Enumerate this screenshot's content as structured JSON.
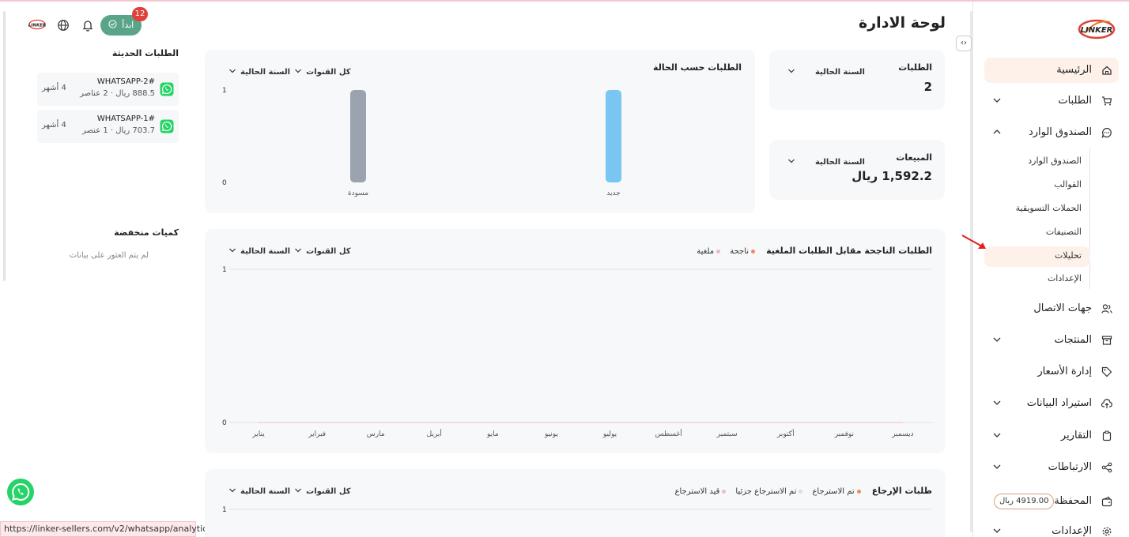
{
  "header": {
    "title": "لوحة الادارة",
    "start_button": "ابدأ",
    "notification_count": "12"
  },
  "sidebar": {
    "items": [
      {
        "label": "الرئيسية",
        "icon": "home-icon",
        "active": true
      },
      {
        "label": "الطلبات",
        "icon": "cart-icon"
      },
      {
        "label": "الصندوق الوارد",
        "icon": "chat-icon"
      },
      {
        "label": "جهات الاتصال",
        "icon": "users-icon"
      },
      {
        "label": "المنتجات",
        "icon": "archive-icon"
      },
      {
        "label": "إدارة الأسعار",
        "icon": "tag-icon"
      },
      {
        "label": "استيراد البيانات",
        "icon": "upload-cloud-icon"
      },
      {
        "label": "التقارير",
        "icon": "clipboard-icon"
      },
      {
        "label": "الارتباطات",
        "icon": "share-icon"
      },
      {
        "label": "المحفظة",
        "icon": "wallet-icon"
      },
      {
        "label": "الإعدادات",
        "icon": "gear-icon"
      }
    ],
    "inbox_sub": [
      "الصندوق الوارد",
      "القوالب",
      "الحملات التسويقية",
      "التصنيفات",
      "تحليلات",
      "الإعدادات"
    ],
    "wallet_balance": "4919.00 ريال"
  },
  "recent_orders": {
    "title": "الطلبات الحديثة",
    "orders": [
      {
        "name": "WHATSAPP-2#",
        "meta": "888.5 ريال · 2 عناصر",
        "time": "4 أشهر"
      },
      {
        "name": "WHATSAPP-1#",
        "meta": "703.7 ريال · 1 عنصر",
        "time": "4 أشهر"
      }
    ]
  },
  "low_stock": {
    "title": "كميات منخفضة",
    "empty": "لم يتم العثور على بيانات"
  },
  "kpis": {
    "orders": {
      "title": "الطلبات",
      "period": "السنة الحالية",
      "value": "2"
    },
    "sales": {
      "title": "المبيعات",
      "period": "السنة الحالية",
      "value": "1,592.2 ريال"
    }
  },
  "filters": {
    "period": "السنة الحالية",
    "channels": "كل القنوات"
  },
  "status_chart": {
    "title": "الطلبات حسب الحالة"
  },
  "success_chart": {
    "title": "الطلبات الناجحة مقابل الطلبات الملغية",
    "legend": [
      {
        "label": "ناجحة",
        "color": "#f08a5d"
      },
      {
        "label": "ملغية",
        "color": "#f5b7c3"
      }
    ]
  },
  "returns_chart": {
    "title": "طلبات الإرجاع",
    "legend": [
      {
        "label": "تم الاسترجاع",
        "color": "#f08a5d"
      },
      {
        "label": "تم الاسترجاع جزئيا",
        "color": "#d9dde2"
      },
      {
        "label": "قيد الاسترجاع",
        "color": "#f5b7c3"
      }
    ]
  },
  "chart_data": [
    {
      "type": "bar",
      "title": "الطلبات حسب الحالة",
      "categories": [
        "مسودة",
        "جديد"
      ],
      "values": [
        1,
        1
      ],
      "colors": [
        "#9aa3ae",
        "#79c6f2"
      ],
      "ylim": [
        0,
        1
      ],
      "yticks": [
        "0",
        "1"
      ]
    },
    {
      "type": "line",
      "title": "الطلبات الناجحة مقابل الطلبات الملغية",
      "categories": [
        "ديسمبر",
        "نوفمبر",
        "أكتوبر",
        "سبتمبر",
        "أغسطس",
        "يوليو",
        "يونيو",
        "مايو",
        "أبريل",
        "مارس",
        "فبراير",
        "يناير"
      ],
      "series": [
        {
          "name": "ناجحة",
          "values": [
            0,
            0,
            0,
            0,
            0,
            0,
            0,
            0,
            0,
            0,
            0,
            0
          ]
        },
        {
          "name": "ملغية",
          "values": [
            0,
            0,
            0,
            0,
            0,
            0,
            0,
            0,
            0,
            0,
            0,
            0
          ]
        }
      ],
      "ylim": [
        0,
        1
      ],
      "yticks": [
        "0",
        "1"
      ]
    },
    {
      "type": "line",
      "title": "طلبات الإرجاع",
      "yticks": [
        "1"
      ]
    }
  ],
  "status_url": "https://linker-sellers.com/v2/whatsapp/analytics"
}
